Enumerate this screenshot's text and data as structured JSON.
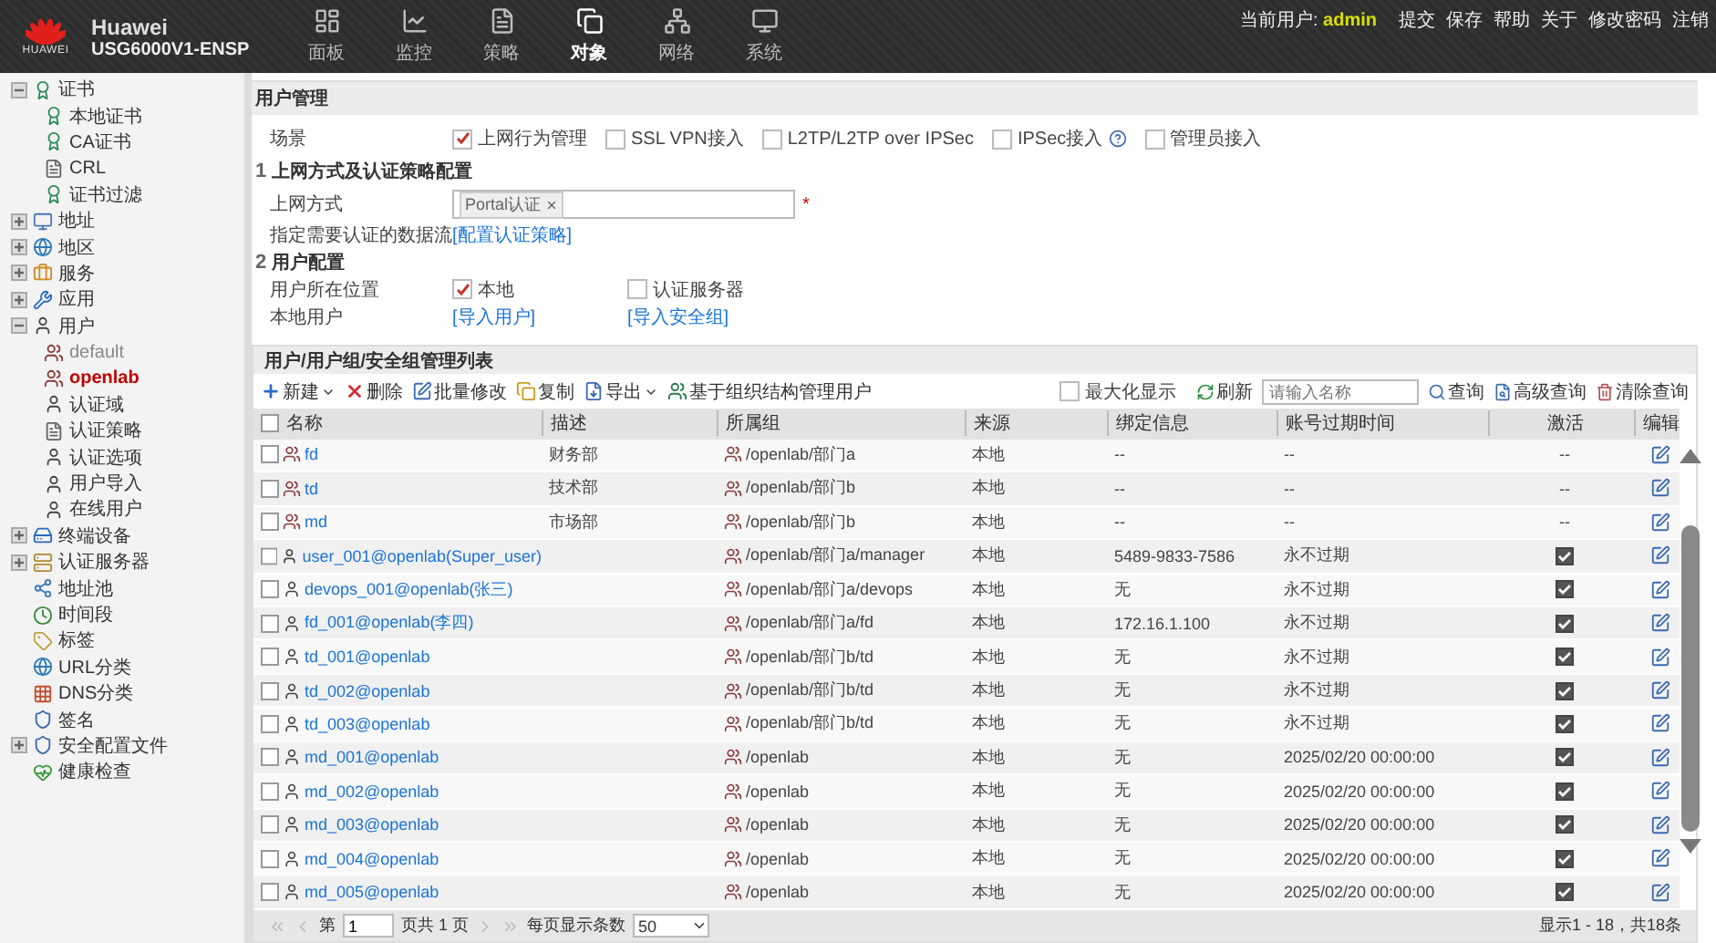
{
  "header": {
    "logo_text": "HUAWEI",
    "brand": "Huawei",
    "model": "USG6000V1-ENSP",
    "nav": [
      {
        "label": "面板",
        "kind": "dashboard",
        "selected": false
      },
      {
        "label": "监控",
        "kind": "monitor",
        "selected": false
      },
      {
        "label": "策略",
        "kind": "policy",
        "selected": false
      },
      {
        "label": "对象",
        "kind": "object",
        "selected": true
      },
      {
        "label": "网络",
        "kind": "network",
        "selected": false
      },
      {
        "label": "系统",
        "kind": "system",
        "selected": false
      }
    ],
    "user_label": "当前用户:",
    "user": "admin",
    "links": [
      "提交",
      "保存",
      "帮助",
      "关于",
      "修改密码",
      "注销"
    ]
  },
  "sidebar": {
    "items": [
      {
        "label": "证书",
        "kind": "cert",
        "expanded": true,
        "selected": false,
        "children": [
          {
            "label": "本地证书",
            "kind": "cert",
            "selected": false
          },
          {
            "label": "CA证书",
            "kind": "cert",
            "selected": false
          },
          {
            "label": "CRL",
            "kind": "doc",
            "selected": false
          },
          {
            "label": "证书过滤",
            "kind": "cert",
            "selected": false
          }
        ]
      },
      {
        "label": "地址",
        "kind": "monitor",
        "expanded": false,
        "selected": false
      },
      {
        "label": "地区",
        "kind": "globe",
        "expanded": false,
        "selected": false
      },
      {
        "label": "服务",
        "kind": "service",
        "expanded": false,
        "selected": false
      },
      {
        "label": "应用",
        "kind": "app",
        "expanded": false,
        "selected": false
      },
      {
        "label": "用户",
        "kind": "user",
        "expanded": true,
        "selected": false,
        "children": [
          {
            "label": "default",
            "kind": "group",
            "selected": false,
            "muted": true
          },
          {
            "label": "openlab",
            "kind": "group",
            "selected": true
          },
          {
            "label": "认证域",
            "kind": "user",
            "selected": false
          },
          {
            "label": "认证策略",
            "kind": "doc",
            "selected": false
          },
          {
            "label": "认证选项",
            "kind": "user",
            "selected": false
          },
          {
            "label": "用户导入",
            "kind": "user",
            "selected": false
          },
          {
            "label": "在线用户",
            "kind": "user",
            "selected": false
          }
        ]
      },
      {
        "label": "终端设备",
        "kind": "device",
        "expanded": false,
        "selected": false
      },
      {
        "label": "认证服务器",
        "kind": "server",
        "expanded": false,
        "selected": false
      },
      {
        "label": "地址池",
        "kind": "pool",
        "selected": false
      },
      {
        "label": "时间段",
        "kind": "time",
        "selected": false
      },
      {
        "label": "标签",
        "kind": "tag",
        "selected": false
      },
      {
        "label": "URL分类",
        "kind": "globe",
        "selected": false
      },
      {
        "label": "DNS分类",
        "kind": "grid",
        "selected": false
      },
      {
        "label": "签名",
        "kind": "shield",
        "selected": false
      },
      {
        "label": "安全配置文件",
        "kind": "shield",
        "expanded": false,
        "selected": false
      },
      {
        "label": "健康检查",
        "kind": "health",
        "selected": false
      }
    ]
  },
  "page": {
    "title": "用户管理",
    "scene_label": "场景",
    "scenes": [
      {
        "label": "上网行为管理",
        "checked": true
      },
      {
        "label": "SSL VPN接入",
        "checked": false
      },
      {
        "label": "L2TP/L2TP over IPSec",
        "checked": false
      },
      {
        "label": "IPSec接入",
        "checked": false,
        "help": true
      },
      {
        "label": "管理员接入",
        "checked": false
      }
    ],
    "section1": {
      "number": "1",
      "title": "上网方式及认证策略配置",
      "access_label": "上网方式",
      "access_tag": "Portal认证",
      "required": "*",
      "flow_label": "指定需要认证的数据流",
      "flow_link": "[配置认证策略]"
    },
    "section2": {
      "number": "2",
      "title": "用户配置",
      "location_label": "用户所在位置",
      "locations": [
        {
          "label": "本地",
          "checked": true
        },
        {
          "label": "认证服务器",
          "checked": false
        }
      ],
      "local_label": "本地用户",
      "local_links": [
        "[导入用户]",
        "[导入安全组]"
      ]
    }
  },
  "table": {
    "title": "用户/用户组/安全组管理列表",
    "toolbar": [
      {
        "label": "新建",
        "kind": "add",
        "menu": true
      },
      {
        "label": "删除",
        "kind": "delete",
        "menu": false
      },
      {
        "label": "批量修改",
        "kind": "edit",
        "menu": false
      },
      {
        "label": "复制",
        "kind": "copy",
        "menu": false
      },
      {
        "label": "导出",
        "kind": "export",
        "menu": true
      },
      {
        "label": "基于组织结构管理用户",
        "kind": "org",
        "menu": false
      }
    ],
    "maximize": {
      "label": "最大化显示",
      "checked": false
    },
    "refresh": "刷新",
    "search_placeholder": "请输入名称",
    "search_tools": [
      {
        "label": "查询",
        "kind": "search"
      },
      {
        "label": "高级查询",
        "kind": "advanced"
      },
      {
        "label": "清除查询",
        "kind": "clear"
      }
    ],
    "select_all": false,
    "columns": [
      "名称",
      "描述",
      "所属组",
      "来源",
      "绑定信息",
      "账号过期时间",
      "激活",
      "编辑"
    ],
    "rows": [
      {
        "kind": "group",
        "checked": false,
        "name": "fd",
        "desc": "财务部",
        "group": "/openlab/部门a",
        "source": "本地",
        "binding": "--",
        "expiry": "--",
        "active": "--"
      },
      {
        "kind": "group",
        "checked": false,
        "name": "td",
        "desc": "技术部",
        "group": "/openlab/部门b",
        "source": "本地",
        "binding": "--",
        "expiry": "--",
        "active": "--"
      },
      {
        "kind": "group",
        "checked": false,
        "name": "md",
        "desc": "市场部",
        "group": "/openlab/部门b",
        "source": "本地",
        "binding": "--",
        "expiry": "--",
        "active": "--"
      },
      {
        "kind": "user",
        "checked": false,
        "name": "user_001@openlab(Super_user)",
        "group": "/openlab/部门a/manager",
        "source": "本地",
        "binding": "5489-9833-7586",
        "expiry": "永不过期",
        "active": true
      },
      {
        "kind": "user",
        "checked": false,
        "name": "devops_001@openlab(张三)",
        "group": "/openlab/部门a/devops",
        "source": "本地",
        "binding": "无",
        "expiry": "永不过期",
        "active": true
      },
      {
        "kind": "user",
        "checked": false,
        "name": "fd_001@openlab(李四)",
        "group": "/openlab/部门a/fd",
        "source": "本地",
        "binding": "172.16.1.100",
        "expiry": "永不过期",
        "active": true
      },
      {
        "kind": "user",
        "checked": false,
        "name": "td_001@openlab",
        "group": "/openlab/部门b/td",
        "source": "本地",
        "binding": "无",
        "expiry": "永不过期",
        "active": true
      },
      {
        "kind": "user",
        "checked": false,
        "name": "td_002@openlab",
        "group": "/openlab/部门b/td",
        "source": "本地",
        "binding": "无",
        "expiry": "永不过期",
        "active": true
      },
      {
        "kind": "user",
        "checked": false,
        "name": "td_003@openlab",
        "group": "/openlab/部门b/td",
        "source": "本地",
        "binding": "无",
        "expiry": "永不过期",
        "active": true
      },
      {
        "kind": "user",
        "checked": false,
        "name": "md_001@openlab",
        "group": "/openlab",
        "source": "本地",
        "binding": "无",
        "expiry": "2025/02/20 00:00:00",
        "active": true
      },
      {
        "kind": "user",
        "checked": false,
        "name": "md_002@openlab",
        "group": "/openlab",
        "source": "本地",
        "binding": "无",
        "expiry": "2025/02/20 00:00:00",
        "active": true
      },
      {
        "kind": "user",
        "checked": false,
        "name": "md_003@openlab",
        "group": "/openlab",
        "source": "本地",
        "binding": "无",
        "expiry": "2025/02/20 00:00:00",
        "active": true
      },
      {
        "kind": "user",
        "checked": false,
        "name": "md_004@openlab",
        "group": "/openlab",
        "source": "本地",
        "binding": "无",
        "expiry": "2025/02/20 00:00:00",
        "active": true
      },
      {
        "kind": "user",
        "checked": false,
        "name": "md_005@openlab",
        "group": "/openlab",
        "source": "本地",
        "binding": "无",
        "expiry": "2025/02/20 00:00:00",
        "active": true
      }
    ],
    "pager": {
      "page_prefix": "第",
      "page": "1",
      "page_suffix": "页共 1 页",
      "per_page_label": "每页显示条数",
      "per_page": "50",
      "status": "显示1 - 18，共18条"
    }
  }
}
